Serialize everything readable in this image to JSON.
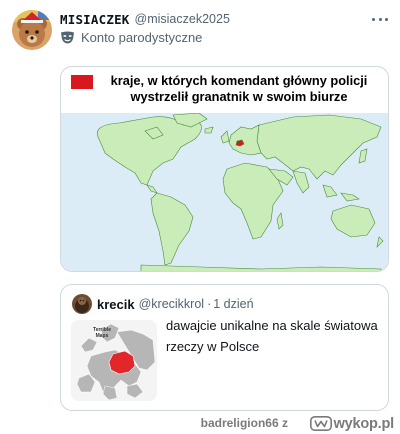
{
  "post": {
    "author": {
      "display_name": "MISIACZEK",
      "handle": "@misiaczek2025",
      "label": "Konto parodystyczne",
      "label_icon": "theater-mask-icon",
      "avatar": "teddy-bear-avatar"
    },
    "more_icon": "more-dots-icon",
    "image": {
      "title": "kraje, w których komendant główny policji wystrzelił granatnik w swoim biurze",
      "legend_color": "#d8171e",
      "map_ocean_color": "#dcecf7",
      "map_land_color": "#c9ecb8",
      "highlight_color": "#d8171e"
    }
  },
  "quote": {
    "author": {
      "display_name": "krecik",
      "handle": "@krecikkrol",
      "separator": "·",
      "time": "1 dzień",
      "avatar": "mole-avatar"
    },
    "thumbnail": {
      "label": "Terrible Maps",
      "highlight_color": "#e12727"
    },
    "text": "dawajcie unikalne na skale światowa rzeczy w Polsce"
  },
  "watermark": {
    "user": "badreligion66",
    "separator": "z",
    "site": "wykop.pl",
    "icon": "wykop-logo-icon"
  }
}
